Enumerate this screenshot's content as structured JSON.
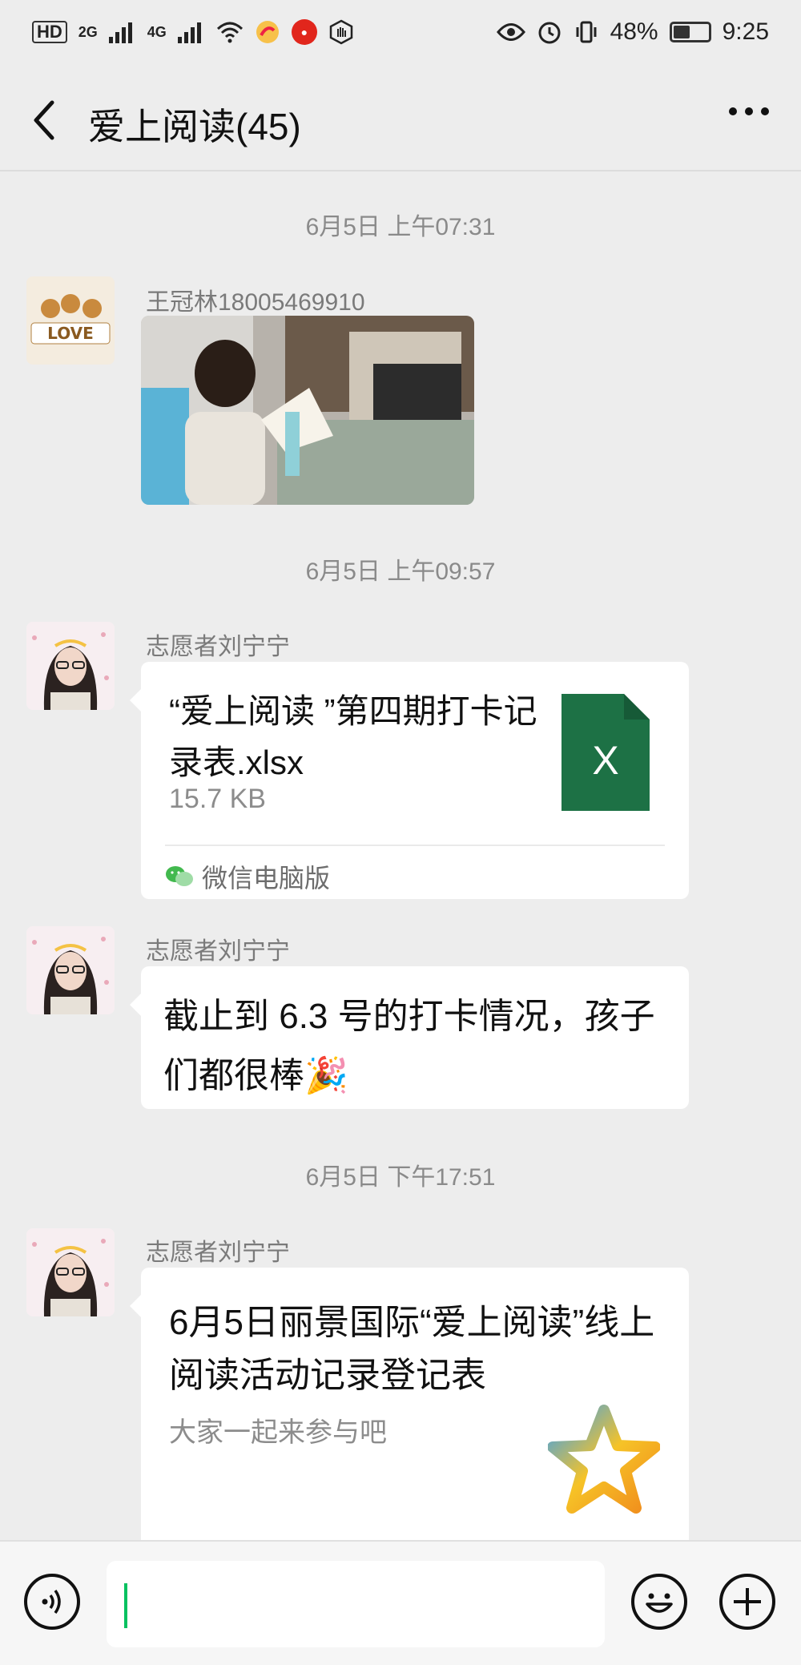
{
  "status_bar": {
    "left_badges": [
      "HD",
      "2G",
      "4G"
    ],
    "battery_percent": "48%",
    "battery_level": 0.48,
    "time": "9:25"
  },
  "header": {
    "title": "爱上阅读(45)"
  },
  "messages": [
    {
      "timestamp": "6月5日 上午07:31",
      "sender": "王冠林18005469910",
      "type": "image"
    },
    {
      "timestamp": "6月5日 上午09:57",
      "sender": "志愿者刘宁宁",
      "type": "file",
      "file_title": "“爱上阅读 ”第四期打卡记录表.xlsx",
      "file_size": "15.7 KB",
      "file_source": "微信电脑版",
      "file_icon_letter": "X"
    },
    {
      "sender": "志愿者刘宁宁",
      "type": "text",
      "text": "截止到 6.3 号的打卡情况，孩子们都很棒🎉"
    },
    {
      "timestamp": "6月5日 下午17:51",
      "sender": "志愿者刘宁宁",
      "type": "link",
      "link_title": "6月5日丽景国际“爱上阅读”线上阅读活动记录登记表",
      "link_desc": "大家一起来参与吧"
    }
  ],
  "colors": {
    "background": "#ededed",
    "bubble": "#ffffff",
    "excel_green": "#1d7145",
    "caret": "#07c160"
  }
}
